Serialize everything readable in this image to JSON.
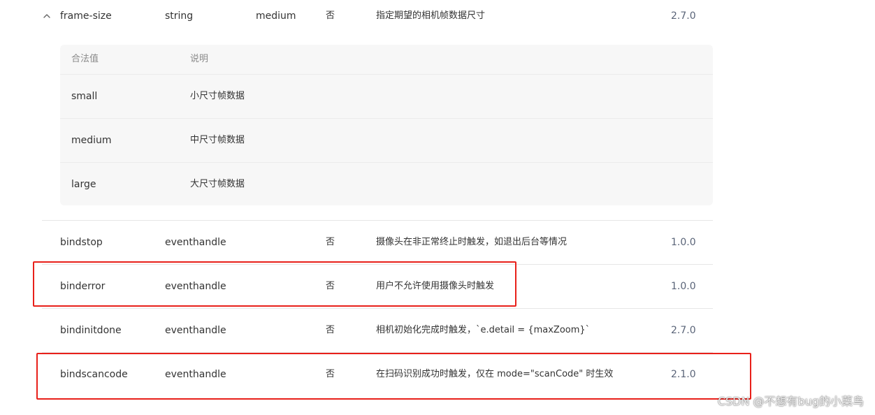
{
  "table": {
    "rows": [
      {
        "name": "frame-size",
        "type": "string",
        "default": "medium",
        "required": "否",
        "description": "指定期望的相机帧数据尺寸",
        "version": "2.7.0",
        "expanded": true,
        "legal_values": {
          "headers": [
            "合法值",
            "说明"
          ],
          "items": [
            {
              "value": "small",
              "description": "小尺寸帧数据"
            },
            {
              "value": "medium",
              "description": "中尺寸帧数据"
            },
            {
              "value": "large",
              "description": "大尺寸帧数据"
            }
          ]
        }
      },
      {
        "name": "bindstop",
        "type": "eventhandle",
        "default": "",
        "required": "否",
        "description": "摄像头在非正常终止时触发，如退出后台等情况",
        "version": "1.0.0"
      },
      {
        "name": "binderror",
        "type": "eventhandle",
        "default": "",
        "required": "否",
        "description": "用户不允许使用摄像头时触发",
        "version": "1.0.0",
        "highlighted": true
      },
      {
        "name": "bindinitdone",
        "type": "eventhandle",
        "default": "",
        "required": "否",
        "description": "相机初始化完成时触发，`e.detail = {maxZoom}`",
        "version": "2.7.0"
      },
      {
        "name": "bindscancode",
        "type": "eventhandle",
        "default": "",
        "required": "否",
        "description": "在扫码识别成功时触发，仅在 mode=\"scanCode\" 时生效",
        "version": "2.1.0",
        "highlighted": true
      }
    ]
  },
  "icons": {
    "expand_toggle": "chevron-up-icon"
  },
  "colors": {
    "highlight_border": "#e8201a",
    "subtable_bg": "#f7f7f7",
    "version_text": "#5a6478"
  },
  "watermark": {
    "text": "CSDN @不想有bug的小菜鸟"
  }
}
